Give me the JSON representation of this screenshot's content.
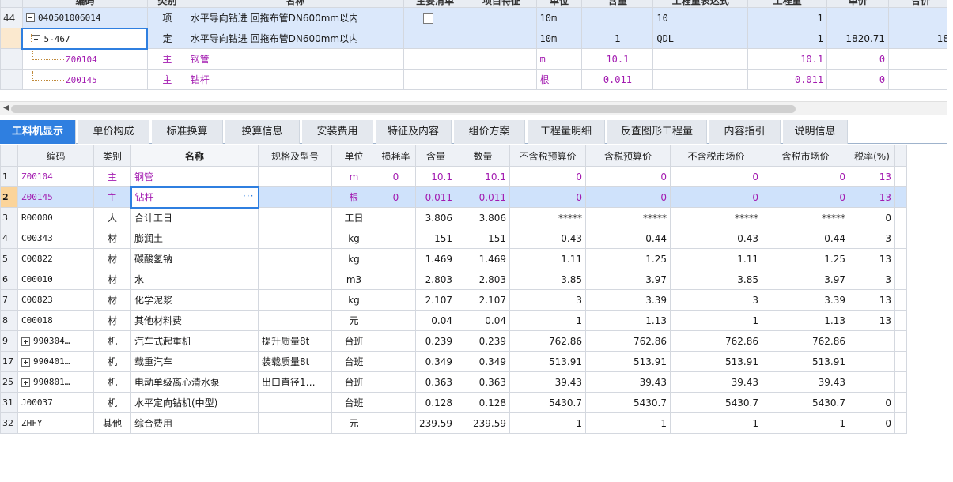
{
  "top_grid": {
    "header": [
      "编码",
      "类别",
      "名称",
      "主要清单",
      "项目特征",
      "单位",
      "含量",
      "工程量表达式",
      "工程量",
      "单价",
      "合价"
    ],
    "rows": [
      {
        "num": "44",
        "code": "040501006014",
        "type": "项",
        "name": "水平导向钻进 回拖布管DN600mm以内",
        "unit": "10m",
        "content": "",
        "expr": "10",
        "qty": "1",
        "price": "",
        "total": ""
      },
      {
        "num": "",
        "code": "5-467",
        "type": "定",
        "name": "水平导向钻进 回拖布管DN600mm以内",
        "unit": "10m",
        "content": "1",
        "expr": "QDL",
        "qty": "1",
        "price": "1820.71",
        "total": "18"
      },
      {
        "num": "",
        "code": "Z00104",
        "type": "主",
        "name": "钢管",
        "unit": "m",
        "content": "10.1",
        "expr": "",
        "qty": "10.1",
        "price": "0",
        "total": ""
      },
      {
        "num": "",
        "code": "Z00145",
        "type": "主",
        "name": "钻杆",
        "unit": "根",
        "content": "0.011",
        "expr": "",
        "qty": "0.011",
        "price": "0",
        "total": ""
      }
    ]
  },
  "tabs": [
    "工料机显示",
    "单价构成",
    "标准换算",
    "换算信息",
    "安装费用",
    "特征及内容",
    "组价方案",
    "工程量明细",
    "反查图形工程量",
    "内容指引",
    "说明信息"
  ],
  "bottom_grid": {
    "headers": [
      "编码",
      "类别",
      "名称",
      "规格及型号",
      "单位",
      "损耗率",
      "含量",
      "数量",
      "不含税预算价",
      "含税预算价",
      "不含税市场价",
      "含税市场价",
      "税率(%)"
    ],
    "rows": [
      {
        "num": "1",
        "code": "Z00104",
        "type": "主",
        "name": "钢管",
        "spec": "",
        "unit": "m",
        "loss": "0",
        "content": "10.1",
        "qty": "10.1",
        "p1": "0",
        "p2": "0",
        "p3": "0",
        "p4": "0",
        "tax": "13"
      },
      {
        "num": "2",
        "code": "Z00145",
        "type": "主",
        "name": "钻杆",
        "spec": "",
        "unit": "根",
        "loss": "0",
        "content": "0.011",
        "qty": "0.011",
        "p1": "0",
        "p2": "0",
        "p3": "0",
        "p4": "0",
        "tax": "13"
      },
      {
        "num": "3",
        "code": "R00000",
        "type": "人",
        "name": "合计工日",
        "spec": "",
        "unit": "工日",
        "loss": "",
        "content": "3.806",
        "qty": "3.806",
        "p1": "*****",
        "p2": "*****",
        "p3": "*****",
        "p4": "*****",
        "tax": "0"
      },
      {
        "num": "4",
        "code": "C00343",
        "type": "材",
        "name": "膨润土",
        "spec": "",
        "unit": "kg",
        "loss": "",
        "content": "151",
        "qty": "151",
        "p1": "0.43",
        "p2": "0.44",
        "p3": "0.43",
        "p4": "0.44",
        "tax": "3"
      },
      {
        "num": "5",
        "code": "C00822",
        "type": "材",
        "name": "碳酸氢钠",
        "spec": "",
        "unit": "kg",
        "loss": "",
        "content": "1.469",
        "qty": "1.469",
        "p1": "1.11",
        "p2": "1.25",
        "p3": "1.11",
        "p4": "1.25",
        "tax": "13"
      },
      {
        "num": "6",
        "code": "C00010",
        "type": "材",
        "name": "水",
        "spec": "",
        "unit": "m3",
        "loss": "",
        "content": "2.803",
        "qty": "2.803",
        "p1": "3.85",
        "p2": "3.97",
        "p3": "3.85",
        "p4": "3.97",
        "tax": "3"
      },
      {
        "num": "7",
        "code": "C00823",
        "type": "材",
        "name": "化学泥浆",
        "spec": "",
        "unit": "kg",
        "loss": "",
        "content": "2.107",
        "qty": "2.107",
        "p1": "3",
        "p2": "3.39",
        "p3": "3",
        "p4": "3.39",
        "tax": "13"
      },
      {
        "num": "8",
        "code": "C00018",
        "type": "材",
        "name": "其他材料费",
        "spec": "",
        "unit": "元",
        "loss": "",
        "content": "0.04",
        "qty": "0.04",
        "p1": "1",
        "p2": "1.13",
        "p3": "1",
        "p4": "1.13",
        "tax": "13"
      },
      {
        "num": "9",
        "code": "990304…",
        "type": "机",
        "name": "汽车式起重机",
        "spec": "提升质量8t",
        "unit": "台班",
        "loss": "",
        "content": "0.239",
        "qty": "0.239",
        "p1": "762.86",
        "p2": "762.86",
        "p3": "762.86",
        "p4": "762.86",
        "tax": ""
      },
      {
        "num": "17",
        "code": "990401…",
        "type": "机",
        "name": "载重汽车",
        "spec": "装载质量8t",
        "unit": "台班",
        "loss": "",
        "content": "0.349",
        "qty": "0.349",
        "p1": "513.91",
        "p2": "513.91",
        "p3": "513.91",
        "p4": "513.91",
        "tax": ""
      },
      {
        "num": "25",
        "code": "990801…",
        "type": "机",
        "name": "电动单级离心清水泵",
        "spec": "出口直径1…",
        "unit": "台班",
        "loss": "",
        "content": "0.363",
        "qty": "0.363",
        "p1": "39.43",
        "p2": "39.43",
        "p3": "39.43",
        "p4": "39.43",
        "tax": ""
      },
      {
        "num": "31",
        "code": "J00037",
        "type": "机",
        "name": "水平定向钻机(中型)",
        "spec": "",
        "unit": "台班",
        "loss": "",
        "content": "0.128",
        "qty": "0.128",
        "p1": "5430.7",
        "p2": "5430.7",
        "p3": "5430.7",
        "p4": "5430.7",
        "tax": "0"
      },
      {
        "num": "32",
        "code": "ZHFY",
        "type": "其他",
        "name": "综合费用",
        "spec": "",
        "unit": "元",
        "loss": "",
        "content": "239.59",
        "qty": "239.59",
        "p1": "1",
        "p2": "1",
        "p3": "1",
        "p4": "1",
        "tax": "0"
      }
    ]
  },
  "ellipsis": "···",
  "scroll_left_icon": "◀",
  "colors": {
    "accent": "#2f7fe0",
    "main_material": "#a21ab0",
    "row_highlight": "#cfe2fb"
  }
}
